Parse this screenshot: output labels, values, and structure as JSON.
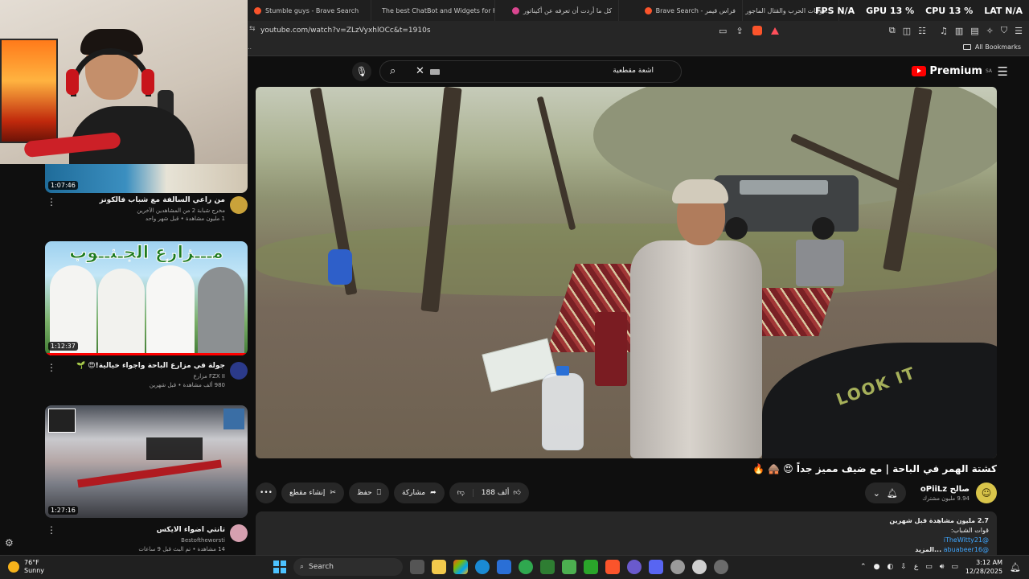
{
  "tabs": [
    {
      "label": "Stumble guys - Brave Search",
      "color": "#fb542b"
    },
    {
      "label": "The best ChatBot and Widgets for Ki",
      "color": "#ffffff"
    },
    {
      "label": "كل ما أردت أن تعرفه عن أكيناتور",
      "color": "#d9468f"
    },
    {
      "label": "فراس قيمر - Brave Search",
      "color": "#fb542b"
    },
    {
      "label": "...هوايات الحرب والقتال الماجور بسيرفر محد",
      "color": "#ff0000"
    }
  ],
  "perf_overlay": {
    "fps_label": "FPS",
    "fps_value": "N/A",
    "gpu_label": "GPU",
    "gpu_value": "13 %",
    "cpu_label": "CPU",
    "cpu_value": "13 %",
    "lat_label": "LAT",
    "lat_value": "N/A"
  },
  "address_bar": {
    "url": "youtube.com/watch?v=ZLzVyxhlOCc&t=1910s"
  },
  "bookmarks": {
    "all_label": "All Bookmarks"
  },
  "youtube_header": {
    "search_query": "اشعة مقطعية",
    "logo_text": "Premium",
    "region": "SA"
  },
  "video": {
    "title": "كشتة الهمر في الباحة | مع ضيف مميز جداً 😍 🛖 🔥",
    "channel_name": "صالح oPiiLz",
    "subscribers": "9.94 مليون مشترك",
    "likes": "188 ألف",
    "share_label": "مشاركة",
    "save_label": "حفظ",
    "clip_label": "إنشاء مقطع",
    "jacket_text": "LOOK IT"
  },
  "description": {
    "stats": "2.7 مليون مشاهدة  قبل شهرين",
    "line2": "قوات الشباب:",
    "link1": "@iTheWitty21",
    "link2": "@abuabeer16",
    "more": "...المزيد"
  },
  "related": [
    {
      "title": "من راعي السالفة مع شباب فالكونز",
      "channel": "مخرج شبابة 2 من المشاهدين الآخرين",
      "views": "1 مليون مشاهدة • قبل شهر واحد",
      "duration": "1:07:46",
      "avatar_color": "#c9a23a"
    },
    {
      "title": "جولة في مزارع الباحة واجواء خيالية!😍 🌱",
      "channel": "FZX II مزارع",
      "views": "980 ألف مشاهدة • قبل شهرين",
      "duration": "1:12:37",
      "banner": "مـــزارع الجـنــوب",
      "avatar_color": "#2b3a8a"
    },
    {
      "title": "تانتي اضواء الايكس",
      "channel": "Bestoftheworsti",
      "views": "14 مشاهدة • تم البث قبل 9 ساعات",
      "duration": "1:27:16",
      "avatar_color": "#d6a0b0"
    }
  ],
  "taskbar": {
    "temperature": "76°F",
    "weather": "Sunny",
    "search_label": "Search",
    "lang": "ع",
    "time": "3:12 AM",
    "date": "12/28/2025"
  }
}
